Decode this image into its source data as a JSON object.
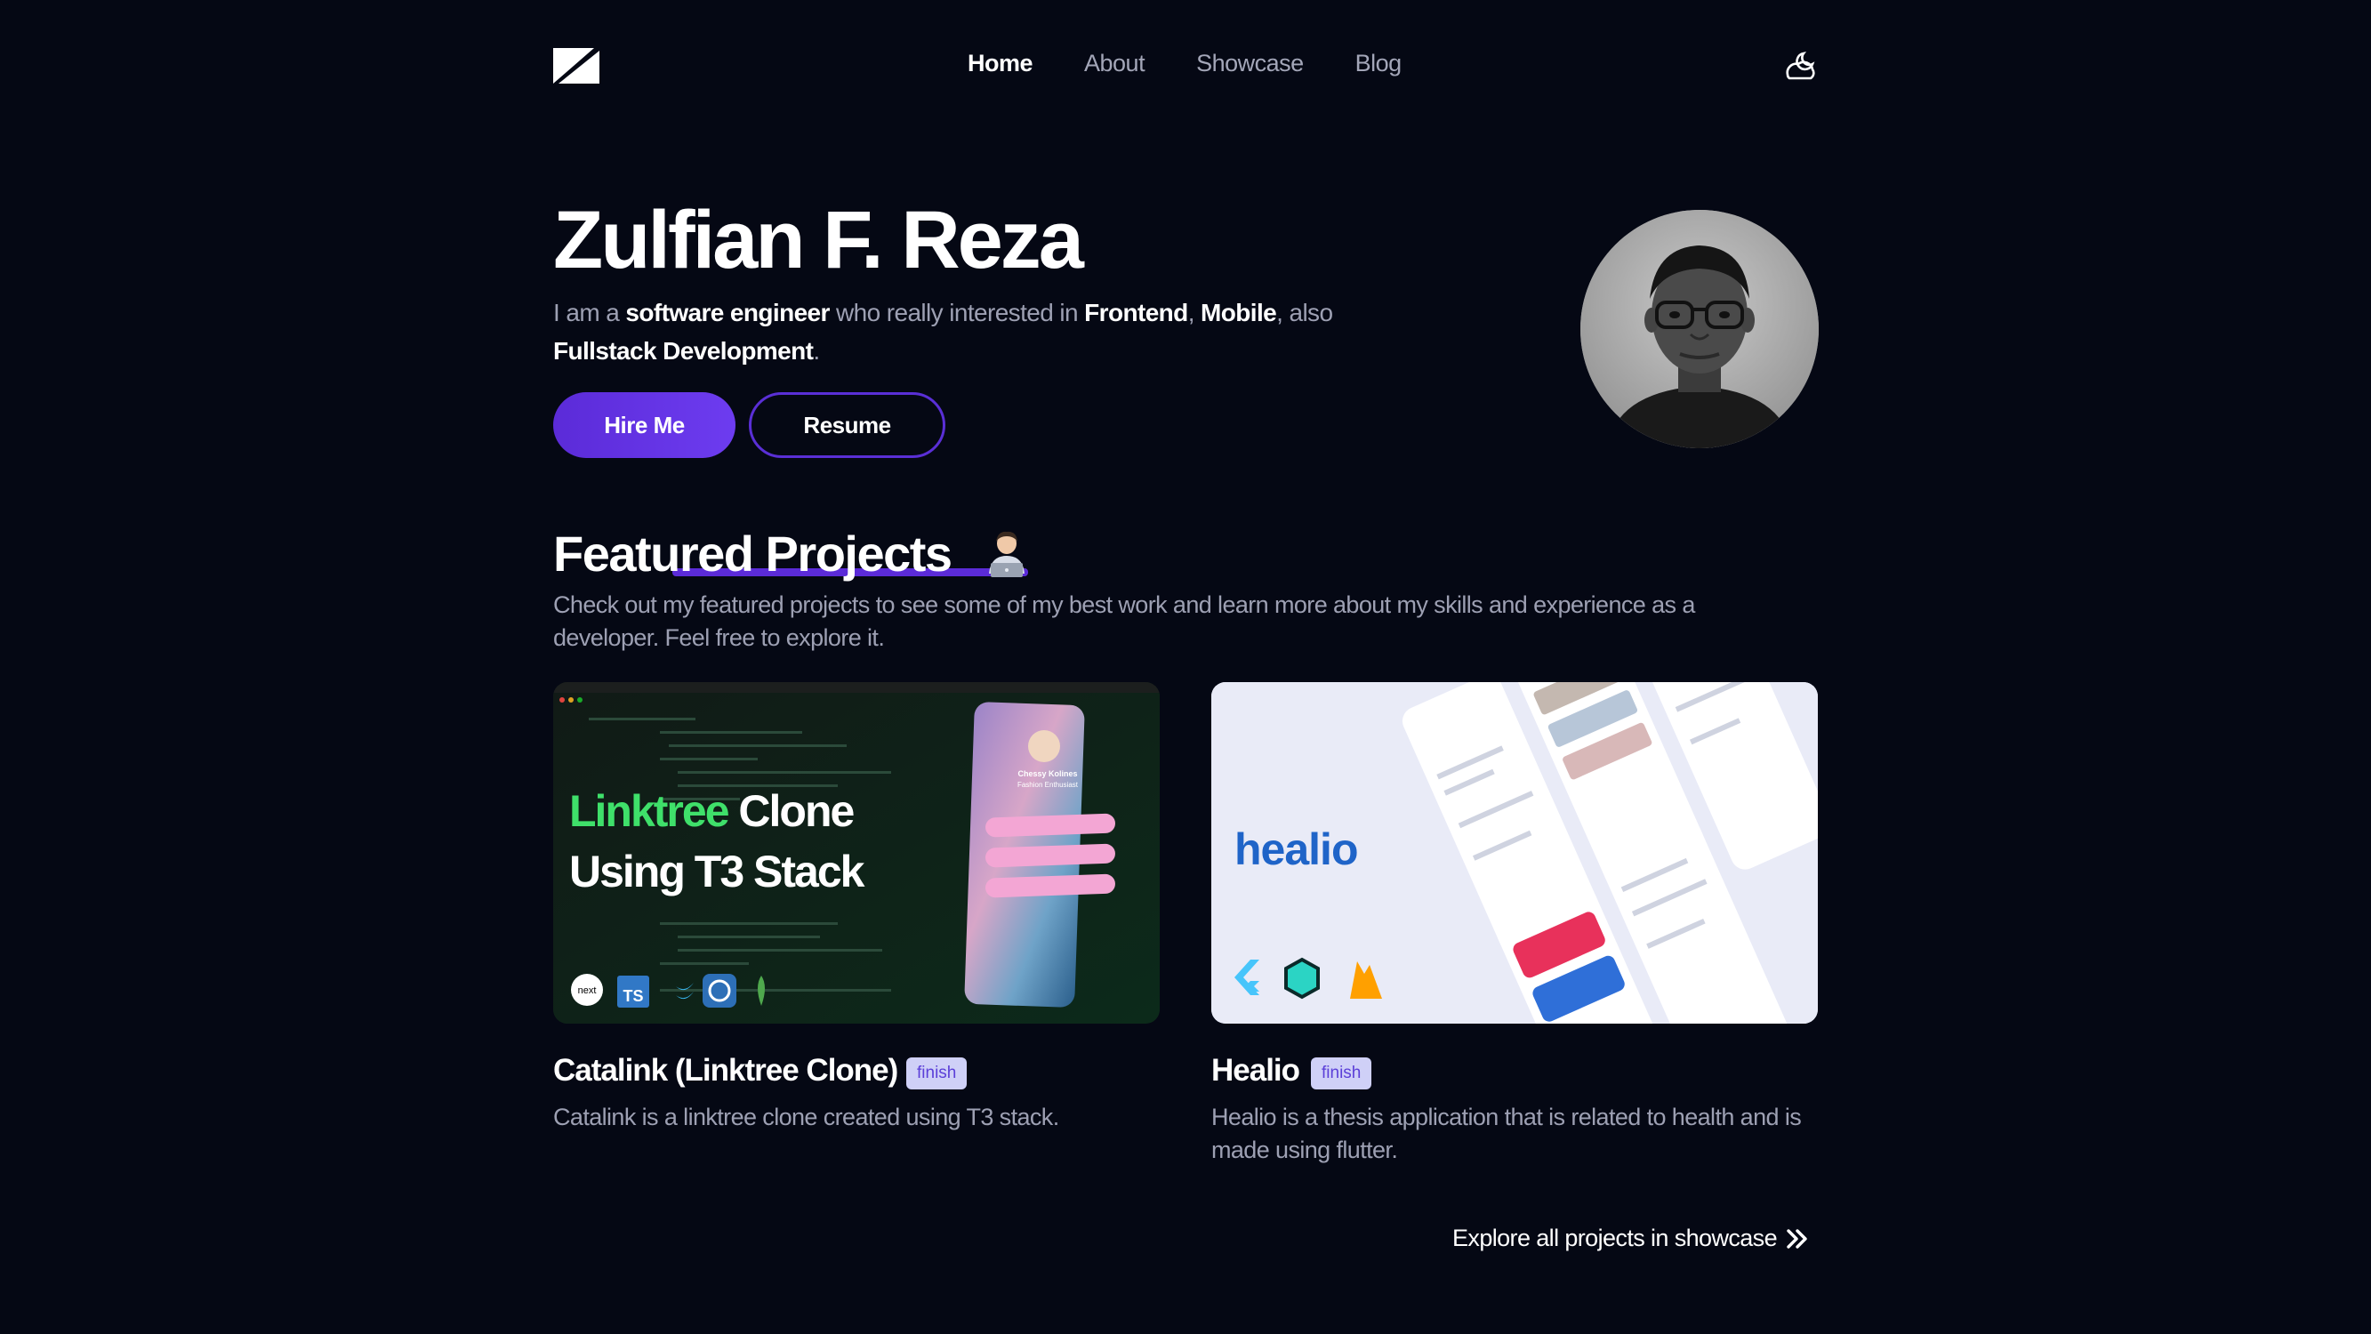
{
  "nav": {
    "links": [
      {
        "label": "Home",
        "active": true
      },
      {
        "label": "About",
        "active": false
      },
      {
        "label": "Showcase",
        "active": false
      },
      {
        "label": "Blog",
        "active": false
      }
    ]
  },
  "hero": {
    "name": "Zulfian F. Reza",
    "desc": {
      "p1": "I am a ",
      "b1": "software engineer",
      "p2": " who really interested in ",
      "b2": "Frontend",
      "p3": ", ",
      "b3": "Mobile",
      "p4": ", also ",
      "b4": "Fullstack Development",
      "p5": "."
    },
    "hire_label": "Hire Me",
    "resume_label": "Resume"
  },
  "featured": {
    "title": "Featured Projects",
    "description": "Check out my featured projects to see some of my best work and learn more about my skills and experience as a developer. Feel free to explore it."
  },
  "projects": [
    {
      "title": "Catalink (Linktree Clone)",
      "badge": "finish",
      "description": "Catalink is a linktree clone created using T3 stack.",
      "thumb": {
        "line1_green": "Linktree",
        "line1_white": " Clone",
        "line2": "Using T3 Stack",
        "phone_name": "Chessy Kolines",
        "phone_sub": "Fashion Enthusiast",
        "tech_icons": [
          "next-icon",
          "typescript-icon",
          "tailwind-icon",
          "prisma-icon",
          "mongodb-icon"
        ],
        "ts_label": "TS",
        "next_label": "next"
      }
    },
    {
      "title": "Healio",
      "badge": "finish",
      "description": "Healio is a thesis application that is related to health and is made using flutter.",
      "thumb": {
        "brand": "healio",
        "tech_icons": [
          "flutter-icon",
          "hive-icon",
          "firebase-icon"
        ]
      }
    }
  ],
  "explore_label": "Explore all projects in showcase",
  "colors": {
    "background": "#050814",
    "accent": "#5b2bd8",
    "badge_bg": "#cfd0f7",
    "linktree_green": "#3fe06a",
    "healio_blue": "#1f64c8"
  }
}
